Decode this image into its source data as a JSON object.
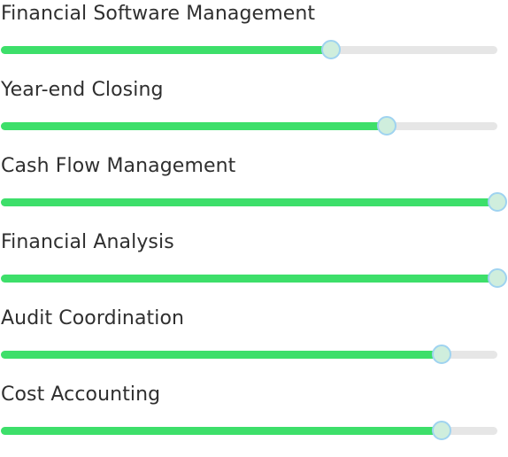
{
  "colors": {
    "fill": "#3ddf6a",
    "track": "#e6e6e6",
    "thumb_border": "#9fd3f0",
    "thumb_center": "#cfeedd",
    "label": "#2f2f2f"
  },
  "skills": [
    {
      "label": "Financial Software Management",
      "level": 0.665
    },
    {
      "label": "Year-end Closing",
      "level": 0.777
    },
    {
      "label": "Cash Flow Management",
      "level": 1.0
    },
    {
      "label": "Financial Analysis",
      "level": 1.0
    },
    {
      "label": "Audit Coordination",
      "level": 0.887
    },
    {
      "label": "Cost Accounting",
      "level": 0.887
    }
  ]
}
